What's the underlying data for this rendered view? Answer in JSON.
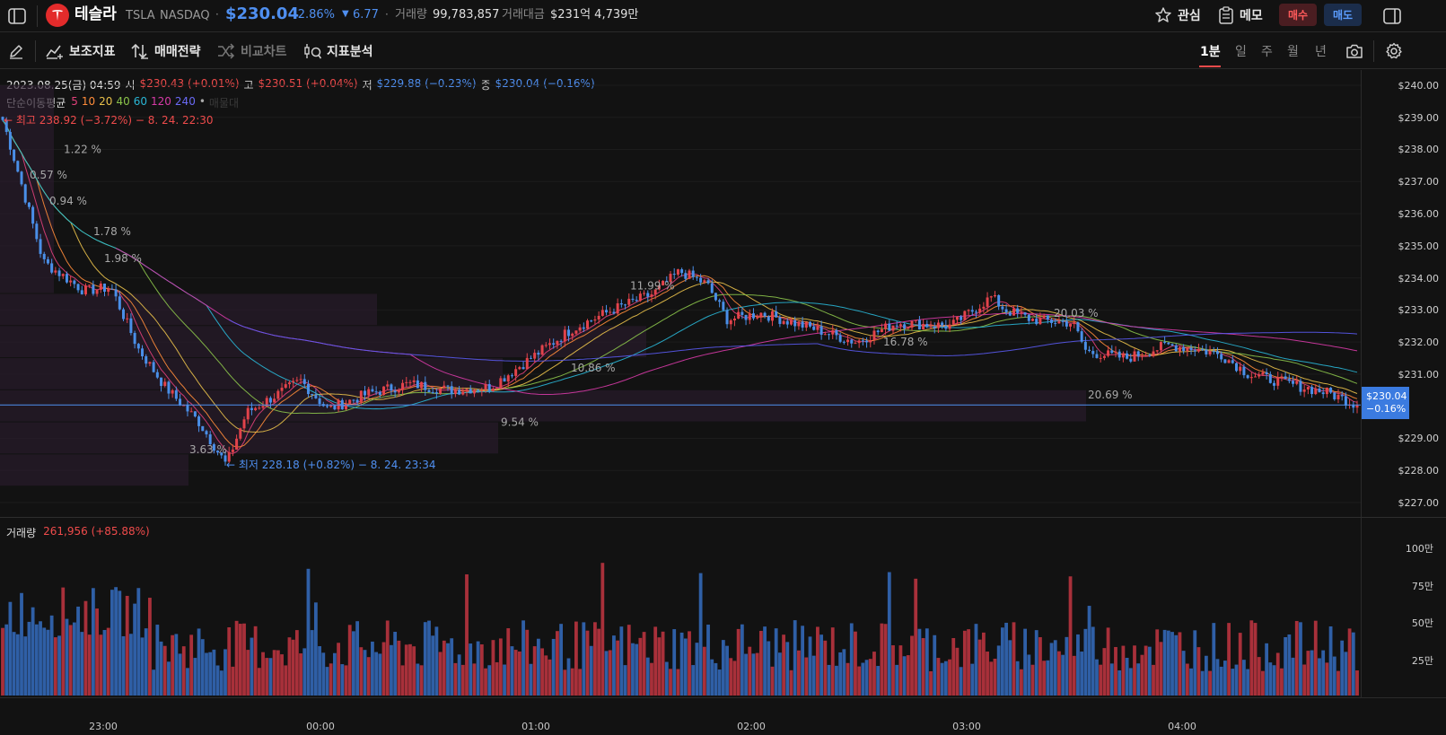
{
  "header": {
    "name": "테슬라",
    "ticker": "TSLA",
    "exchange": "NASDAQ",
    "price": "$230.04",
    "change_pct": "-2.86%",
    "change_abs": "6.77",
    "volume_label": "거래량",
    "volume": "99,783,857",
    "turnover_label": "거래대금",
    "turnover": "$231억 4,739만",
    "watch_label": "관심",
    "memo_label": "메모",
    "buy_label": "매수",
    "sell_label": "매도"
  },
  "toolbar": {
    "indicators_label": "보조지표",
    "strategy_label": "매매전략",
    "compare_label": "비교차트",
    "analysis_label": "지표분석",
    "timeframes": [
      "1분",
      "일",
      "주",
      "월",
      "년"
    ],
    "active_timeframe": "1분"
  },
  "ohlc": {
    "date": "2023.08.25(금) 04:59",
    "open_label": "시",
    "open": "$230.43 (+0.01%)",
    "high_label": "고",
    "high": "$230.51 (+0.04%)",
    "low_label": "저",
    "low": "$229.88 (−0.23%)",
    "close_label": "종",
    "close": "$230.04 (−0.16%)"
  },
  "ma": {
    "label": "단순이동평균",
    "periods": [
      "5",
      "10",
      "20",
      "40",
      "60",
      "120",
      "240"
    ],
    "colors": [
      "#e0407a",
      "#ff8c3a",
      "#e8c04a",
      "#8bc34a",
      "#29b6d6",
      "#d63aa6",
      "#5a5af0"
    ],
    "trailing": "매물대"
  },
  "annotations": {
    "high": "← 최고 238.92 (−3.72%) − 8. 24. 22:30",
    "low": "← 최저 228.18 (+0.82%) − 8. 24. 23:34",
    "vp_labels": [
      "1.22 %",
      "0.57 %",
      "0.94 %",
      "1.78 %",
      "1.98 %",
      "11.99 %",
      "20.03 %",
      "16.78 %",
      "10.86 %",
      "20.69 %",
      "9.54 %",
      "3.63 %"
    ]
  },
  "price_axis": [
    "$240.00",
    "$239.00",
    "$238.00",
    "$237.00",
    "$236.00",
    "$235.00",
    "$234.00",
    "$233.00",
    "$232.00",
    "$231.00",
    "$229.00",
    "$228.00",
    "$227.00"
  ],
  "current_price": {
    "price": "$230.04",
    "change": "−0.16%"
  },
  "volume_panel": {
    "label": "거래량",
    "value": "261,956 (+85.88%)",
    "axis": [
      "100만",
      "75만",
      "50만",
      "25만"
    ]
  },
  "time_axis": [
    "23:00",
    "00:00",
    "01:00",
    "02:00",
    "03:00",
    "04:00"
  ],
  "chart_data": {
    "type": "candlestick",
    "interval": "1m",
    "ylim": [
      227,
      240
    ],
    "yticks": [
      240,
      239,
      238,
      237,
      236,
      235,
      234,
      233,
      232,
      231,
      229,
      228,
      227
    ],
    "anchor_points": [
      [
        0,
        238.92
      ],
      [
        0.01,
        237.5
      ],
      [
        0.03,
        234.5
      ],
      [
        0.06,
        233.6
      ],
      [
        0.08,
        233.7
      ],
      [
        0.1,
        231.8
      ],
      [
        0.12,
        230.6
      ],
      [
        0.145,
        229.5
      ],
      [
        0.165,
        228.18
      ],
      [
        0.18,
        229.8
      ],
      [
        0.2,
        230.3
      ],
      [
        0.22,
        230.8
      ],
      [
        0.24,
        229.9
      ],
      [
        0.27,
        230.4
      ],
      [
        0.3,
        230.7
      ],
      [
        0.33,
        230.5
      ],
      [
        0.36,
        230.6
      ],
      [
        0.38,
        231.2
      ],
      [
        0.42,
        232.4
      ],
      [
        0.45,
        233.0
      ],
      [
        0.48,
        233.5
      ],
      [
        0.5,
        234.2
      ],
      [
        0.52,
        233.8
      ],
      [
        0.535,
        232.7
      ],
      [
        0.56,
        232.9
      ],
      [
        0.6,
        232.4
      ],
      [
        0.63,
        232.0
      ],
      [
        0.66,
        232.6
      ],
      [
        0.7,
        232.5
      ],
      [
        0.73,
        233.4
      ],
      [
        0.74,
        233.0
      ],
      [
        0.76,
        232.7
      ],
      [
        0.79,
        232.6
      ],
      [
        0.8,
        231.7
      ],
      [
        0.83,
        231.5
      ],
      [
        0.86,
        231.9
      ],
      [
        0.88,
        231.8
      ],
      [
        0.9,
        231.6
      ],
      [
        0.92,
        231.0
      ],
      [
        0.95,
        230.7
      ],
      [
        0.98,
        230.4
      ],
      [
        1,
        230.04
      ]
    ],
    "current": 230.04,
    "volume_axis": [
      "100만",
      "75만",
      "50만",
      "25만"
    ]
  }
}
